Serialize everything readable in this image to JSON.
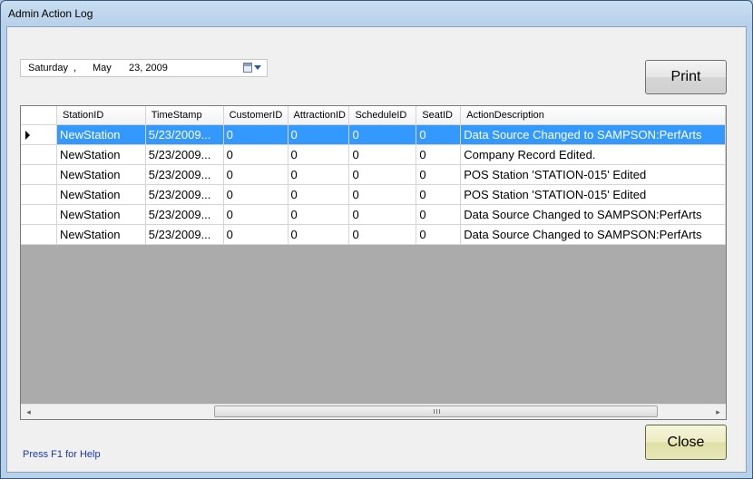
{
  "window": {
    "title": "Admin Action Log"
  },
  "date_picker": {
    "day_name": "Saturday",
    "separator": ",",
    "month": "May",
    "day_year": "23, 2009"
  },
  "buttons": {
    "print": "Print",
    "close": "Close"
  },
  "grid": {
    "columns": [
      "StationID",
      "TimeStamp",
      "CustomerID",
      "AttractionID",
      "ScheduleID",
      "SeatID",
      "ActionDescription"
    ],
    "rows": [
      [
        "NewStation",
        "5/23/2009...",
        "0",
        "0",
        "0",
        "0",
        "Data Source Changed to SAMPSON:PerfArts"
      ],
      [
        "NewStation",
        "5/23/2009...",
        "0",
        "0",
        "0",
        "0",
        "Company Record Edited."
      ],
      [
        "NewStation",
        "5/23/2009...",
        "0",
        "0",
        "0",
        "0",
        "POS Station 'STATION-015' Edited"
      ],
      [
        "NewStation",
        "5/23/2009...",
        "0",
        "0",
        "0",
        "0",
        "POS Station 'STATION-015' Edited"
      ],
      [
        "NewStation",
        "5/23/2009...",
        "0",
        "0",
        "0",
        "0",
        "Data Source Changed to SAMPSON:PerfArts"
      ],
      [
        "NewStation",
        "5/23/2009...",
        "0",
        "0",
        "0",
        "0",
        "Data Source Changed to SAMPSON:PerfArts"
      ]
    ],
    "selected_row": 0
  },
  "scrollbar": {
    "left_arrow": "◂",
    "right_arrow": "▸"
  },
  "status": {
    "help_text": "Press F1 for Help"
  },
  "colors": {
    "selection": "#3399ff",
    "grid_background": "#ababab",
    "close_button": "#ecebc0"
  },
  "icons": {
    "calendar": "calendar-icon",
    "dropdown": "chevron-down-icon",
    "row_pointer": "row-pointer-icon"
  }
}
